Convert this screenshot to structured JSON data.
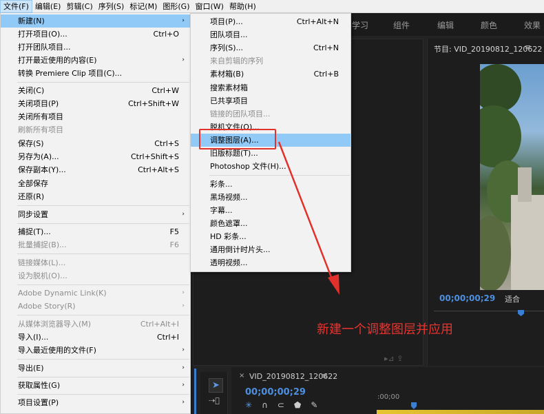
{
  "menubar": {
    "items": [
      "文件(F)",
      "编辑(E)",
      "剪辑(C)",
      "序列(S)",
      "标记(M)",
      "图形(G)",
      "窗口(W)",
      "帮助(H)"
    ]
  },
  "workspace_tabs": [
    "学习",
    "组件",
    "编辑",
    "颜色",
    "效果"
  ],
  "file_menu": {
    "items": [
      {
        "label": "新建(N)",
        "shortcut": "",
        "arrow": "›",
        "highlight": true
      },
      {
        "label": "打开项目(O)...",
        "shortcut": "Ctrl+O"
      },
      {
        "label": "打开团队项目..."
      },
      {
        "label": "打开最近使用的内容(E)",
        "arrow": "›"
      },
      {
        "label": "转换 Premiere Clip 项目(C)..."
      },
      {
        "label": "关闭(C)",
        "shortcut": "Ctrl+W"
      },
      {
        "label": "关闭项目(P)",
        "shortcut": "Ctrl+Shift+W"
      },
      {
        "label": "关闭所有项目"
      },
      {
        "label": "刷新所有项目",
        "disabled": true
      },
      {
        "label": "保存(S)",
        "shortcut": "Ctrl+S"
      },
      {
        "label": "另存为(A)...",
        "shortcut": "Ctrl+Shift+S"
      },
      {
        "label": "保存副本(Y)...",
        "shortcut": "Ctrl+Alt+S"
      },
      {
        "label": "全部保存"
      },
      {
        "label": "还原(R)"
      },
      {
        "label": "同步设置",
        "arrow": "›"
      },
      {
        "label": "捕捉(T)...",
        "shortcut": "F5"
      },
      {
        "label": "批量捕捉(B)...",
        "shortcut": "F6",
        "disabled": true
      },
      {
        "label": "链接媒体(L)...",
        "disabled": true
      },
      {
        "label": "设为脱机(O)...",
        "disabled": true
      },
      {
        "label": "Adobe Dynamic Link(K)",
        "arrow": "›",
        "disabled": true
      },
      {
        "label": "Adobe Story(R)",
        "arrow": "›",
        "disabled": true
      },
      {
        "label": "从媒体浏览器导入(M)",
        "shortcut": "Ctrl+Alt+I",
        "disabled": true
      },
      {
        "label": "导入(I)...",
        "shortcut": "Ctrl+I"
      },
      {
        "label": "导入最近使用的文件(F)",
        "arrow": "›"
      },
      {
        "label": "导出(E)",
        "arrow": "›"
      },
      {
        "label": "获取属性(G)",
        "arrow": "›"
      },
      {
        "label": "项目设置(P)",
        "arrow": "›"
      }
    ]
  },
  "submenu": {
    "items": [
      {
        "label": "项目(P)...",
        "shortcut": "Ctrl+Alt+N"
      },
      {
        "label": "团队项目..."
      },
      {
        "label": "序列(S)...",
        "shortcut": "Ctrl+N"
      },
      {
        "label": "来自剪辑的序列",
        "disabled": true
      },
      {
        "label": "素材箱(B)",
        "shortcut": "Ctrl+B"
      },
      {
        "label": "搜索素材箱"
      },
      {
        "label": "已共享项目"
      },
      {
        "label": "链接的团队项目...",
        "disabled": true
      },
      {
        "label": "脱机文件(O)..."
      },
      {
        "label": "调整图层(A)...",
        "highlight": true
      },
      {
        "label": "旧版标题(T)..."
      },
      {
        "label": "Photoshop 文件(H)..."
      },
      {
        "label": "彩条..."
      },
      {
        "label": "黑场视频..."
      },
      {
        "label": "字幕..."
      },
      {
        "label": "颜色遮罩..."
      },
      {
        "label": "HD 彩条..."
      },
      {
        "label": "通用倒计时片头..."
      },
      {
        "label": "透明视频..."
      }
    ]
  },
  "program_monitor": {
    "title": "节目: VID_20190812_120622",
    "menu_icon": "≡",
    "timecode": "00;00;00;29",
    "fit": "适合"
  },
  "timeline": {
    "close_icon": "×",
    "title": "VID_20190812_120622",
    "menu_icon": "≡",
    "timecode": "00;00;00;29",
    "ruler_label": ":00;00"
  },
  "annotation": {
    "text": "新建一个调整图层并应用",
    "color": "#e8332f"
  },
  "colors": {
    "menu_highlight": "#91c9f7",
    "accent_blue": "#3a7fd6",
    "annotation_red": "#e2302b"
  }
}
